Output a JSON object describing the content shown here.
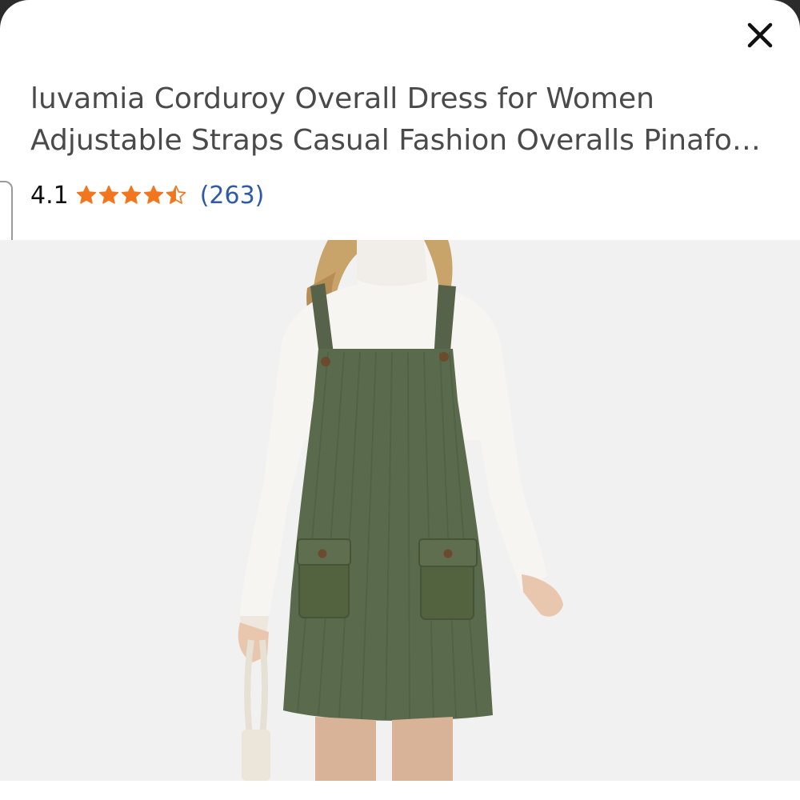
{
  "product": {
    "title": "luvamia Corduroy Overall Dress for Women Adjustable Straps Casual Fashion Overalls Pinafo…",
    "rating_value": "4.1",
    "rating_fraction": 0.82,
    "review_count": "(263)"
  },
  "icons": {
    "close": "close-icon",
    "star_full": "star-filled-icon",
    "star_half": "star-half-icon"
  },
  "colors": {
    "star": "#f1761d",
    "review_link": "#2f5aa8",
    "title_text": "#4a4a4a",
    "image_background": "#f2f1f1"
  }
}
